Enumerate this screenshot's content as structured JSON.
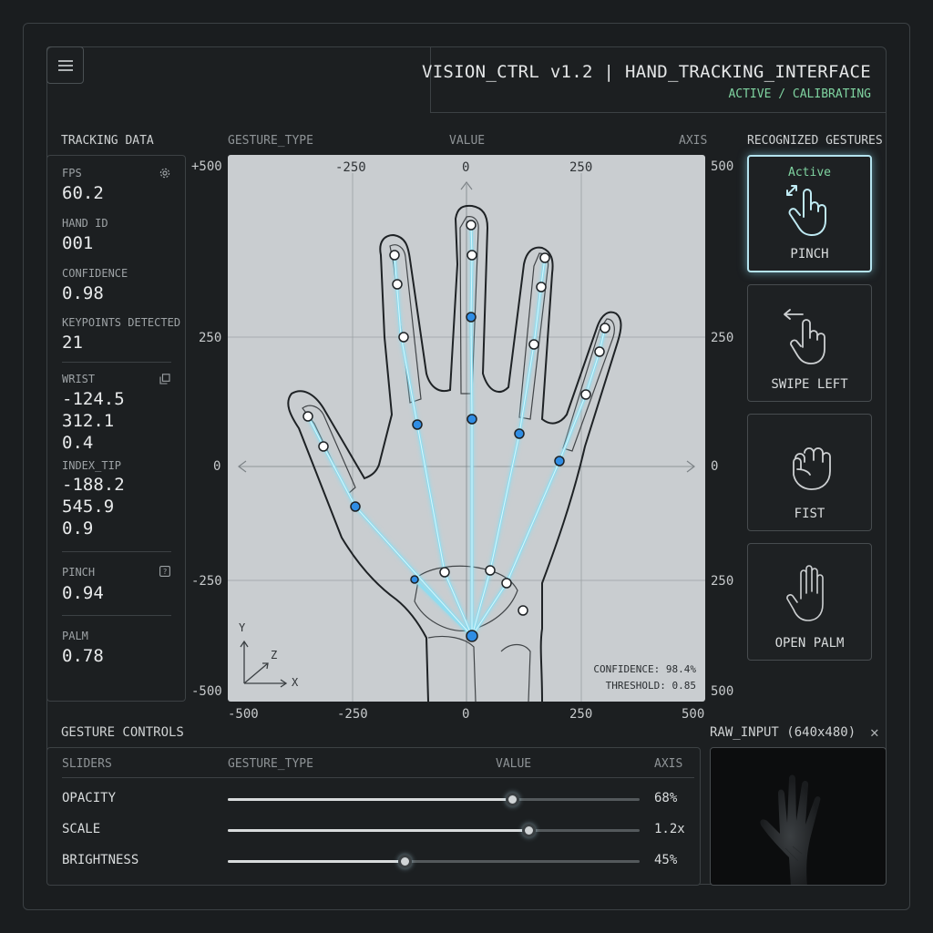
{
  "header": {
    "title": "VISION_CTRL v1.2 | HAND_TRACKING_INTERFACE",
    "status": "ACTIVE / CALIBRATING"
  },
  "columns": {
    "tracking_data": "TRACKING DATA",
    "gesture_type": "GESTURE_TYPE",
    "value": "VALUE",
    "axis": "AXIS",
    "recognized": "RECOGNIZED GESTURES"
  },
  "tracking": {
    "fps_label": "FPS",
    "fps_value": "60.2",
    "hand_id_label": "HAND ID",
    "hand_id_value": "001",
    "confidence_label": "CONFIDENCE",
    "confidence_value": "0.98",
    "keypoints_label": "KEYPOINTS DETECTED",
    "keypoints_value": "21",
    "wrist_label": "WRIST",
    "wrist_x": "-124.5",
    "wrist_y": "312.1",
    "wrist_z": "0.4",
    "index_label": "INDEX_TIP",
    "index_x": "-188.2",
    "index_y": "545.9",
    "index_z": "0.9",
    "pinch_label": "PINCH",
    "pinch_value": "0.94",
    "palm_label": "PALM",
    "palm_value": "0.78"
  },
  "view": {
    "top_ticks": [
      "-250",
      "0",
      "250"
    ],
    "left_ticks": [
      "+500",
      "250",
      "0",
      "-250",
      "-500"
    ],
    "right_ticks": [
      "500",
      "250",
      "0",
      "250",
      "500"
    ],
    "bottom_ticks": [
      "-500",
      "-250",
      "0",
      "250",
      "500"
    ],
    "confidence": "CONFIDENCE: 98.4%",
    "threshold": "THRESHOLD: 0.85",
    "axis_y": "Y",
    "axis_z": "Z",
    "axis_x": "X"
  },
  "gestures": [
    {
      "label": "PINCH",
      "active": "Active",
      "icon": "pinch-hand-icon"
    },
    {
      "label": "SWIPE LEFT",
      "icon": "swipe-left-hand-icon"
    },
    {
      "label": "FIST",
      "icon": "fist-icon"
    },
    {
      "label": "OPEN PALM",
      "icon": "open-palm-icon"
    }
  ],
  "controls": {
    "title": "GESTURE CONTROLS",
    "col_sliders": "SLIDERS",
    "col_gesture_type": "GESTURE_TYPE",
    "col_value": "VALUE",
    "col_axis": "AXIS",
    "sliders": [
      {
        "name": "OPACITY",
        "value": "68%",
        "level": 0.69
      },
      {
        "name": "SCALE",
        "value": "1.2x",
        "level": 0.73
      },
      {
        "name": "BRIGHTNESS",
        "value": "45%",
        "level": 0.43
      }
    ]
  },
  "raw_input": {
    "title": "RAW_INPUT (640x480)",
    "close": "✕"
  },
  "colors": {
    "accent_green": "#7fd3a0",
    "glow_blue": "#8fdcef",
    "joint_blue": "#2f8de4"
  }
}
